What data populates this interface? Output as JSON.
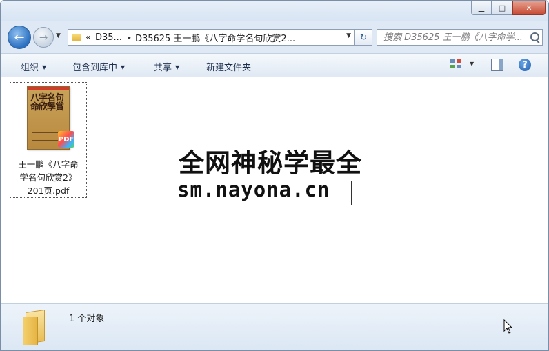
{
  "window": {
    "minimize_label": "▁",
    "maximize_label": "□",
    "close_label": "✕"
  },
  "nav": {
    "back_icon": "←",
    "forward_icon": "→",
    "history_dropdown": "▼"
  },
  "address": {
    "overflow": "«",
    "crumbs": [
      "D35...",
      "D35625 王一鹏《八字命学名句欣赏2..."
    ],
    "separator": "▸",
    "dropdown": "▼",
    "refresh_icon": "↻"
  },
  "search": {
    "placeholder": "搜索 D35625 王一鹏《八字命学..."
  },
  "toolbar": {
    "organize": "组织",
    "include_library": "包含到库中",
    "share": "共享",
    "new_folder": "新建文件夹",
    "dropdown": "▼",
    "help": "?"
  },
  "files": [
    {
      "name_line1": "王一鹏《八字命",
      "name_line2": "学名句欣赏2》",
      "name_line3": "201页.pdf",
      "thumb_title": "八字名句命欣學賞",
      "badge": "PDF"
    }
  ],
  "watermark": {
    "line1": "全网神秘学最全",
    "line2": "sm.nayona.cn"
  },
  "status": {
    "count_text": "1 个对象"
  }
}
